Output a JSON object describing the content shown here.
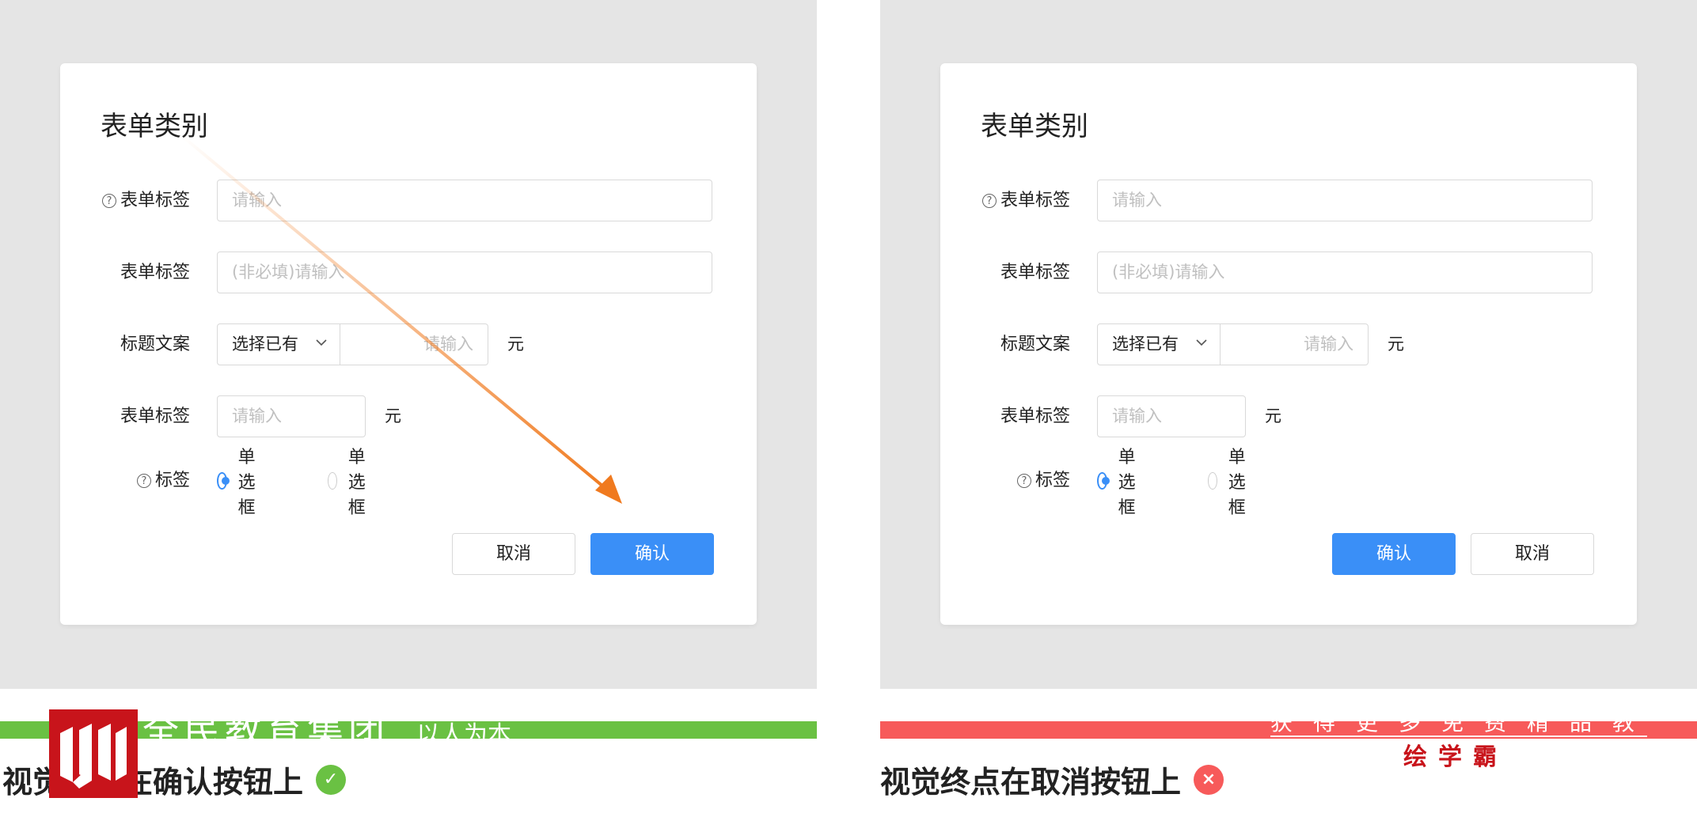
{
  "dialog": {
    "title": "表单类别",
    "rows": {
      "tag_required": {
        "label": "表单标签",
        "placeholder": "请输入"
      },
      "tag_optional": {
        "label": "表单标签",
        "placeholder": "(非必填)请输入"
      },
      "title_copy": {
        "label": "标题文案",
        "select_value": "选择已有",
        "placeholder": "请输入",
        "unit": "元"
      },
      "tag_amount": {
        "label": "表单标签",
        "placeholder": "请输入",
        "unit": "元"
      },
      "radio": {
        "label": "标签",
        "option1": "单选框",
        "option2": "单选框"
      }
    },
    "buttons": {
      "cancel": "取消",
      "confirm": "确认"
    }
  },
  "captions": {
    "left": "视觉终点在确认按钮上",
    "right": "视觉终点在取消按钮上"
  },
  "watermarks": {
    "left_text": "全民教育集团",
    "left_slogan": "以人为本",
    "right_line1": "获得更多免费精品教程",
    "right_brand": "绘学霸"
  },
  "colors": {
    "primary": "#3a8ff7",
    "good": "#6ac143",
    "bad": "#f75a5a",
    "arrow": "#f07a1f",
    "watermark_red": "#c8141b"
  },
  "icons": {
    "help": "question-circle-icon",
    "chevron": "chevron-down-icon",
    "good": "check-circle-icon",
    "bad": "close-circle-icon"
  }
}
